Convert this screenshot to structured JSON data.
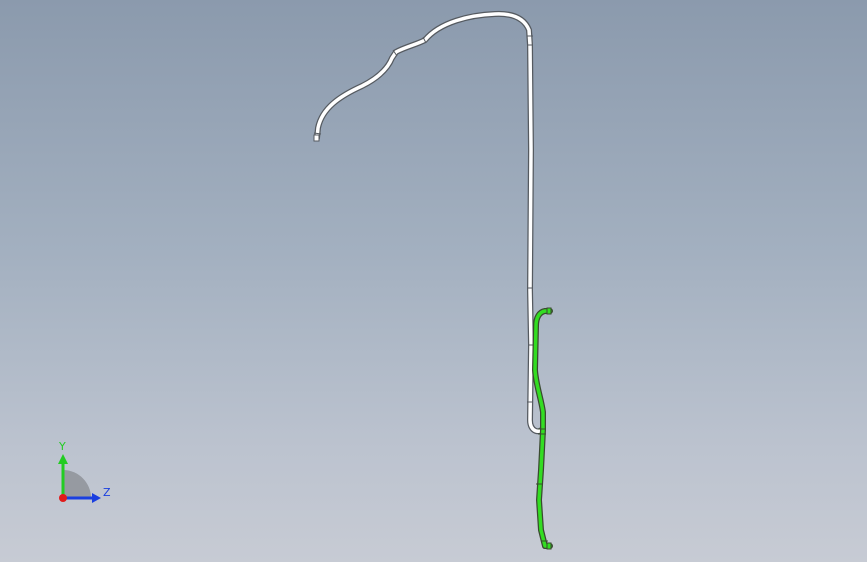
{
  "viewport": {
    "background_top": "#8b9aad",
    "background_bottom": "#c7cbd4"
  },
  "model": {
    "parts": [
      {
        "name": "white-pipe",
        "color": "#ffffff",
        "outline": "#555a60"
      },
      {
        "name": "green-pipe",
        "color": "#33dd22",
        "outline": "#3a4a30"
      }
    ]
  },
  "triad": {
    "y_label": "Y",
    "z_label": "Z",
    "y_color": "#22cc22",
    "z_color": "#1a3fe0",
    "x_color": "#e01a1a"
  }
}
